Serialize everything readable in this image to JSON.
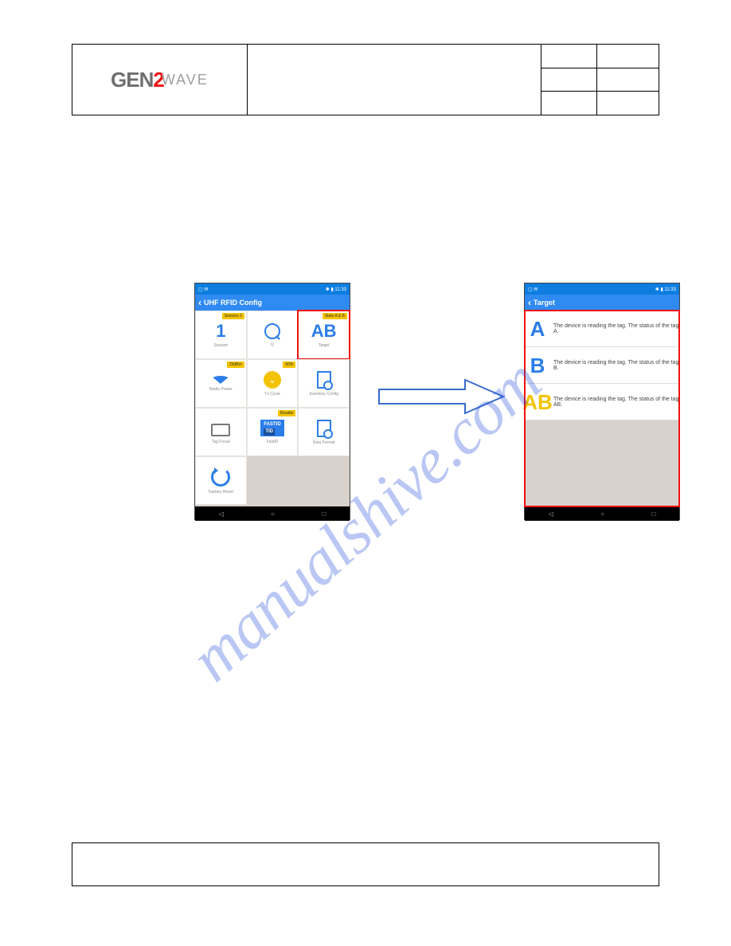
{
  "header": {
    "logo_part1": "GEN",
    "logo_part2": "2",
    "logo_part3": "WAVE"
  },
  "watermark": "manualshive.com",
  "left_phone": {
    "status_time": "11:33",
    "title": "UHF RFID Config",
    "tiles": [
      {
        "icon": "1",
        "label": "Session",
        "badge": "Session 3"
      },
      {
        "icon": "Q",
        "label": "Q",
        "badge": ""
      },
      {
        "icon": "AB",
        "label": "Target",
        "badge": "State A & B",
        "highlight": true
      },
      {
        "icon": "wifi",
        "label": "Radio Power",
        "badge": "25dBm"
      },
      {
        "icon": "wifi-y",
        "label": "Tx Cycle",
        "badge": "50%"
      },
      {
        "icon": "doc-gear",
        "label": "Inventory Config",
        "badge": ""
      },
      {
        "icon": "tagfocus",
        "label": "Tag Focus",
        "badge": ""
      },
      {
        "icon": "fastid",
        "label": "FastID",
        "badge": "Disable"
      },
      {
        "icon": "doc-gear",
        "label": "Data Format",
        "badge": ""
      },
      {
        "icon": "reset",
        "label": "Factory Reset",
        "badge": ""
      }
    ]
  },
  "right_phone": {
    "status_time": "11:33",
    "title": "Target",
    "rows": [
      {
        "icon": "A",
        "cls": "li-a",
        "text": "The device is reading the tag. The status of the tag A."
      },
      {
        "icon": "B",
        "cls": "li-b",
        "text": "The device is reading the tag. The status of the tag B."
      },
      {
        "icon": "AB",
        "cls": "li-ab",
        "text": "The device is reading the tag. The status of the tag AB."
      }
    ]
  },
  "nav": {
    "back": "◁",
    "home": "○",
    "recent": "□"
  }
}
